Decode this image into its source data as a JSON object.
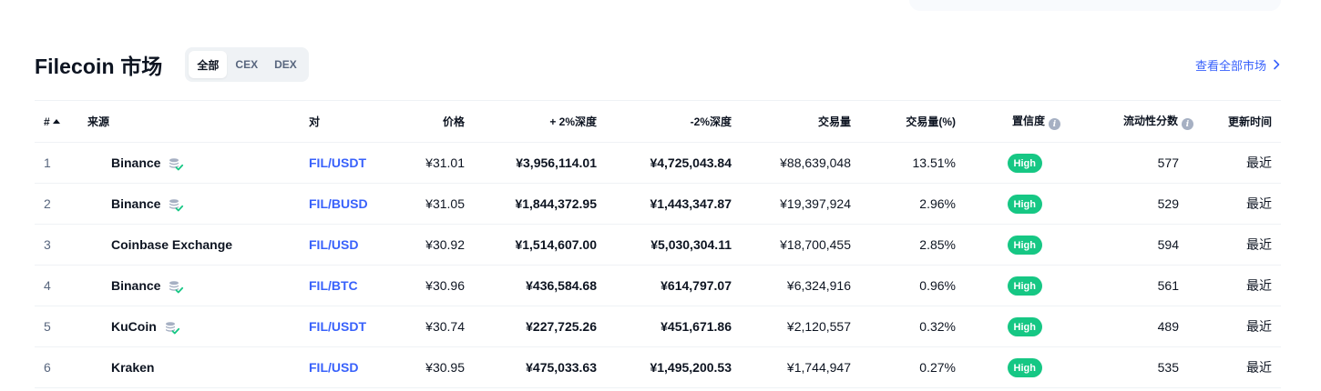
{
  "header": {
    "title": "Filecoin 市场",
    "tabs": [
      "全部",
      "CEX",
      "DEX"
    ],
    "active_tab": 0,
    "view_all": "查看全部市场"
  },
  "table": {
    "columns": {
      "rank": "#",
      "source": "来源",
      "pair": "对",
      "price": "价格",
      "depth_plus": "+ 2%深度",
      "depth_minus": "-2%深度",
      "volume": "交易量",
      "volume_pct": "交易量(%)",
      "confidence": "置信度",
      "liquidity": "流动性分数",
      "updated": "更新时间"
    },
    "rows": [
      {
        "rank": "1",
        "source": "Binance",
        "verified": true,
        "pair": "FIL/USDT",
        "price": "¥31.01",
        "depth_plus": "¥3,956,114.01",
        "depth_minus": "¥4,725,043.84",
        "volume": "¥88,639,048",
        "volume_pct": "13.51%",
        "confidence": "High",
        "liquidity": "577",
        "updated": "最近"
      },
      {
        "rank": "2",
        "source": "Binance",
        "verified": true,
        "pair": "FIL/BUSD",
        "price": "¥31.05",
        "depth_plus": "¥1,844,372.95",
        "depth_minus": "¥1,443,347.87",
        "volume": "¥19,397,924",
        "volume_pct": "2.96%",
        "confidence": "High",
        "liquidity": "529",
        "updated": "最近"
      },
      {
        "rank": "3",
        "source": "Coinbase Exchange",
        "verified": false,
        "pair": "FIL/USD",
        "price": "¥30.92",
        "depth_plus": "¥1,514,607.00",
        "depth_minus": "¥5,030,304.11",
        "volume": "¥18,700,455",
        "volume_pct": "2.85%",
        "confidence": "High",
        "liquidity": "594",
        "updated": "最近"
      },
      {
        "rank": "4",
        "source": "Binance",
        "verified": true,
        "pair": "FIL/BTC",
        "price": "¥30.96",
        "depth_plus": "¥436,584.68",
        "depth_minus": "¥614,797.07",
        "volume": "¥6,324,916",
        "volume_pct": "0.96%",
        "confidence": "High",
        "liquidity": "561",
        "updated": "最近"
      },
      {
        "rank": "5",
        "source": "KuCoin",
        "verified": true,
        "pair": "FIL/USDT",
        "price": "¥30.74",
        "depth_plus": "¥227,725.26",
        "depth_minus": "¥451,671.86",
        "volume": "¥2,120,557",
        "volume_pct": "0.32%",
        "confidence": "High",
        "liquidity": "489",
        "updated": "最近"
      },
      {
        "rank": "6",
        "source": "Kraken",
        "verified": false,
        "pair": "FIL/USD",
        "price": "¥30.95",
        "depth_plus": "¥475,033.63",
        "depth_minus": "¥1,495,200.53",
        "volume": "¥1,744,947",
        "volume_pct": "0.27%",
        "confidence": "High",
        "liquidity": "535",
        "updated": "最近"
      }
    ]
  },
  "icons": {
    "sort": "sort-ascending-icon",
    "info": "info-icon",
    "verified": "verified-reserves-icon",
    "chevron": "chevron-right-icon"
  },
  "colors": {
    "link": "#3861fb",
    "high_badge": "#16c784",
    "text": "#0d1421",
    "muted": "#58667e"
  }
}
